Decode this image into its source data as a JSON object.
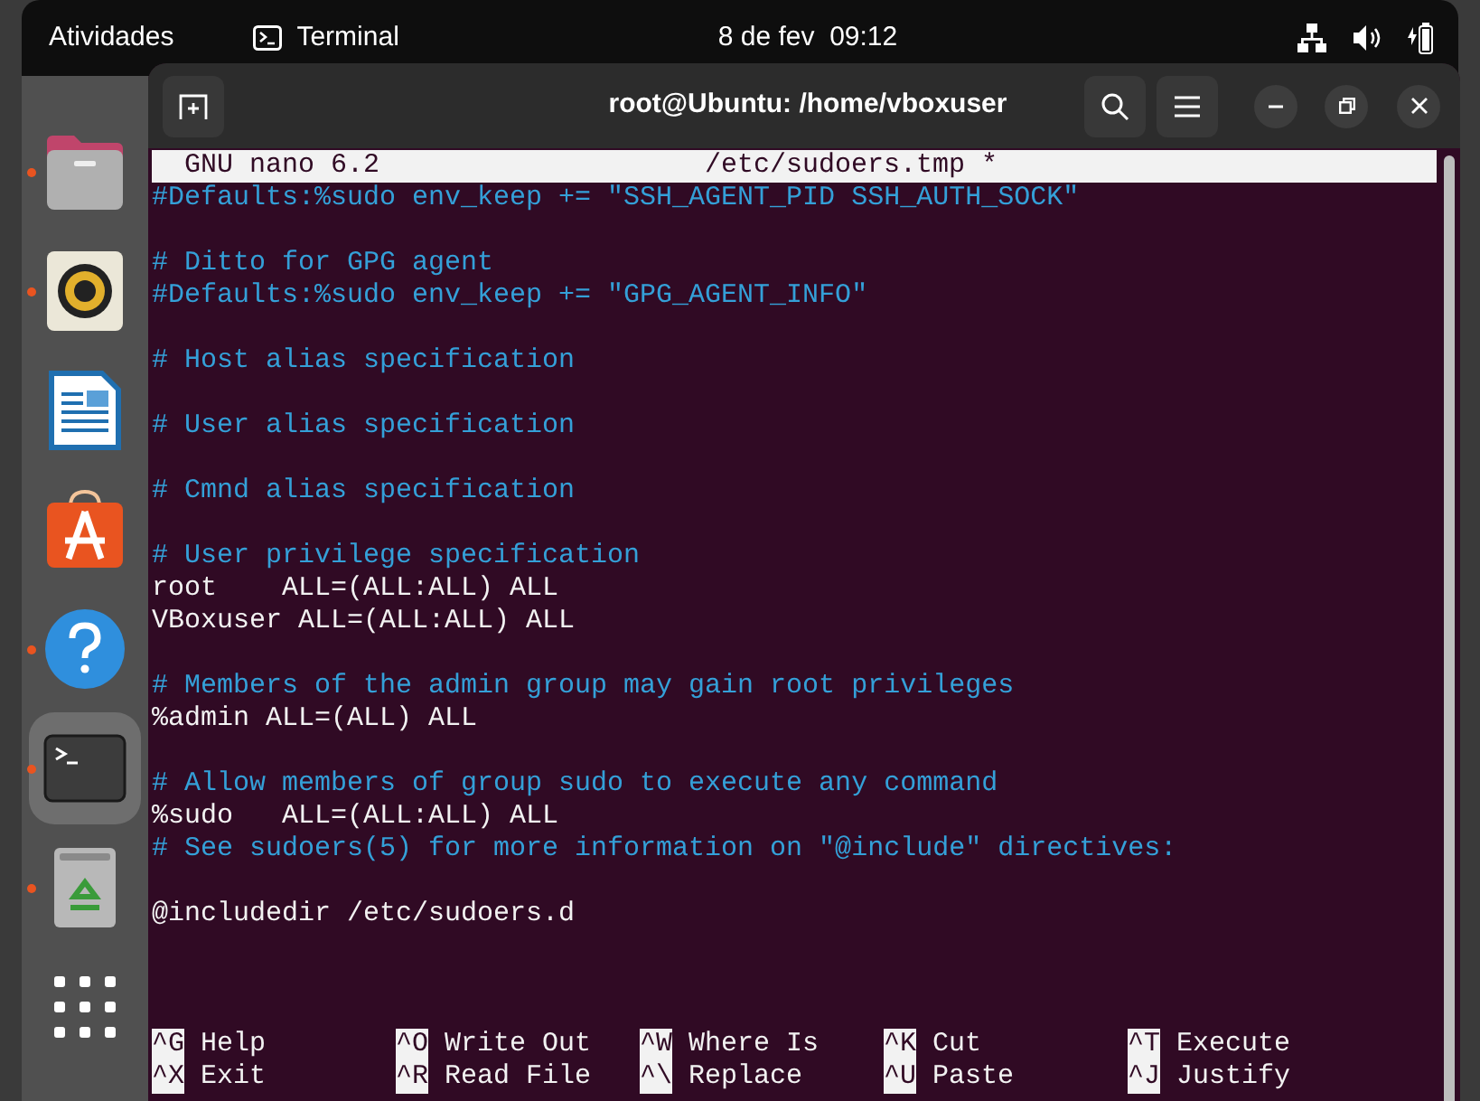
{
  "top_bar": {
    "activities": "Atividades",
    "app_name": "Terminal",
    "clock": "8 de fev  09:12"
  },
  "dock": {
    "items": [
      {
        "kind": "files",
        "running": true,
        "selected": false
      },
      {
        "kind": "music",
        "running": true,
        "selected": false
      },
      {
        "kind": "writer",
        "running": false,
        "selected": false
      },
      {
        "kind": "store",
        "running": false,
        "selected": false
      },
      {
        "kind": "help",
        "running": true,
        "selected": false
      },
      {
        "kind": "terminal",
        "running": true,
        "selected": true
      },
      {
        "kind": "trash",
        "running": true,
        "selected": false
      },
      {
        "kind": "grid",
        "running": false,
        "selected": false
      }
    ]
  },
  "window": {
    "title": "root@Ubuntu: /home/vboxuser"
  },
  "nano": {
    "version": "GNU nano 6.2",
    "file": "/etc/sudoers.tmp *",
    "lines": [
      {
        "kind": "comment",
        "text": "#Defaults:%sudo env_keep += \"SSH_AGENT_PID SSH_AUTH_SOCK\""
      },
      {
        "kind": "blank"
      },
      {
        "kind": "comment",
        "text": "# Ditto for GPG agent"
      },
      {
        "kind": "comment",
        "text": "#Defaults:%sudo env_keep += \"GPG_AGENT_INFO\""
      },
      {
        "kind": "blank"
      },
      {
        "kind": "comment",
        "text": "# Host alias specification"
      },
      {
        "kind": "blank"
      },
      {
        "kind": "comment",
        "text": "# User alias specification"
      },
      {
        "kind": "blank"
      },
      {
        "kind": "comment",
        "text": "# Cmnd alias specification"
      },
      {
        "kind": "blank"
      },
      {
        "kind": "comment",
        "text": "# User privilege specification"
      },
      {
        "kind": "code",
        "text": "root    ALL=(ALL:ALL) ALL"
      },
      {
        "kind": "code",
        "text": "VBoxuser ALL=(ALL:ALL) ALL"
      },
      {
        "kind": "blank"
      },
      {
        "kind": "comment",
        "text": "# Members of the admin group may gain root privileges"
      },
      {
        "kind": "code",
        "text": "%admin ALL=(ALL) ALL"
      },
      {
        "kind": "blank"
      },
      {
        "kind": "comment",
        "text": "# Allow members of group sudo to execute any command"
      },
      {
        "kind": "code",
        "text": "%sudo   ALL=(ALL:ALL) ALL"
      },
      {
        "kind": "comment",
        "text": "# See sudoers(5) for more information on \"@include\" directives:"
      },
      {
        "kind": "blank"
      },
      {
        "kind": "code",
        "text": "@includedir /etc/sudoers.d"
      }
    ],
    "shortcuts": [
      {
        "key": "^G",
        "label": "Help"
      },
      {
        "key": "^X",
        "label": "Exit"
      },
      {
        "key": "^O",
        "label": "Write Out"
      },
      {
        "key": "^R",
        "label": "Read File"
      },
      {
        "key": "^W",
        "label": "Where Is"
      },
      {
        "key": "^\\",
        "label": "Replace"
      },
      {
        "key": "^K",
        "label": "Cut"
      },
      {
        "key": "^U",
        "label": "Paste"
      },
      {
        "key": "^T",
        "label": "Execute"
      },
      {
        "key": "^J",
        "label": "Justify"
      }
    ]
  }
}
